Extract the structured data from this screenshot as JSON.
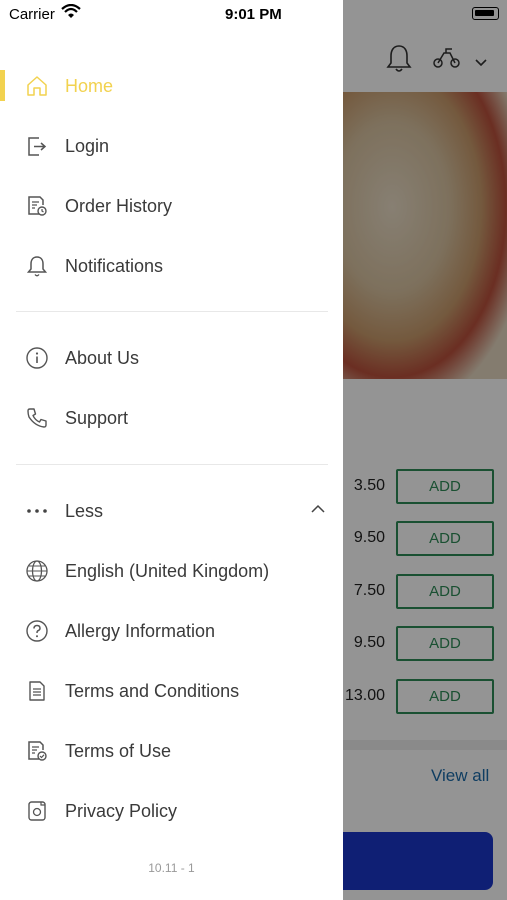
{
  "status_bar": {
    "carrier": "Carrier",
    "time": "9:01 PM"
  },
  "menu": {
    "primary": [
      {
        "label": "Home",
        "icon": "home-icon",
        "active": true
      },
      {
        "label": "Login",
        "icon": "login-icon"
      },
      {
        "label": "Order History",
        "icon": "order-history-icon"
      },
      {
        "label": "Notifications",
        "icon": "bell-icon"
      }
    ],
    "secondary": [
      {
        "label": "About Us",
        "icon": "info-icon"
      },
      {
        "label": "Support",
        "icon": "phone-icon"
      }
    ],
    "more_toggle": {
      "label": "Less",
      "icon": "ellipsis-icon",
      "expanded": true
    },
    "tertiary": [
      {
        "label": "English (United Kingdom)",
        "icon": "globe-icon"
      },
      {
        "label": "Allergy Information",
        "icon": "question-circle-icon"
      },
      {
        "label": "Terms and Conditions",
        "icon": "document-icon"
      },
      {
        "label": "Terms of Use",
        "icon": "document-check-icon"
      },
      {
        "label": "Privacy Policy",
        "icon": "privacy-icon"
      }
    ],
    "version": "10.11 - 1"
  },
  "background": {
    "prices": [
      "3.50",
      "9.50",
      "7.50",
      "9.50",
      "13.00"
    ],
    "add_label": "ADD",
    "view_all": "View all"
  },
  "colors": {
    "accent": "#f2d24f",
    "text": "#3a3a3a",
    "add_green": "#2e8b57",
    "blue_button": "#1b36c9"
  }
}
